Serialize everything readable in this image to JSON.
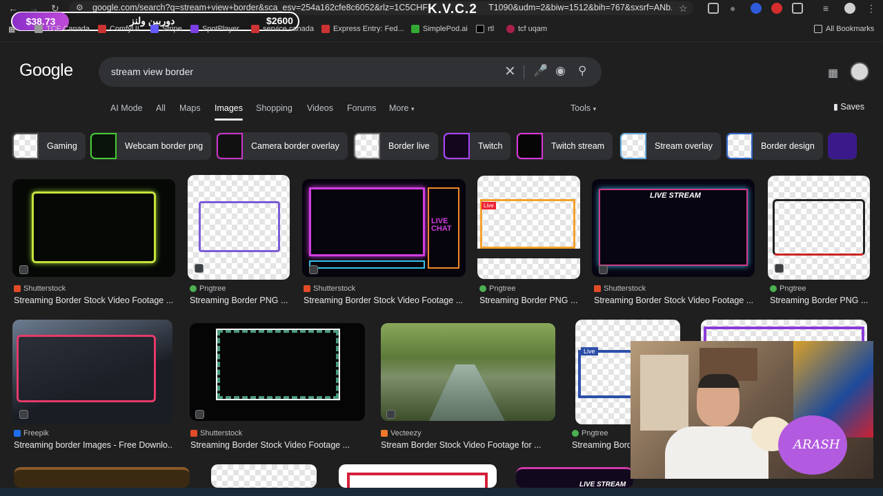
{
  "browser": {
    "url": "google.com/search?q=stream+view+border&sca_esv=254a162cfe8c6052&rlz=1C5CHF",
    "url_tail": "T1090&udm=2&biw=1512&bih=767&sxsrf=ANb...",
    "bookmarks": [
      "TCF Canada",
      "ComfyUI",
      "Stripe",
      "SpotPlayer",
      "service canada",
      "Express Entry: Fed...",
      "SimplePod.ai",
      "rtl",
      "tcf uqam",
      "All Bookmarks"
    ]
  },
  "overlay": {
    "left_money": "$38.73",
    "arabic": "دوربین ولنز",
    "right_money": "$2600",
    "brand": "K.V.C.2"
  },
  "google": {
    "logo": "Google",
    "query": "stream view border",
    "tabs": [
      "AI Mode",
      "All",
      "Maps",
      "Images",
      "Shopping",
      "Videos",
      "Forums",
      "More",
      "Tools"
    ],
    "saves": "Saves"
  },
  "chips": [
    "Gaming",
    "Webcam border png",
    "Camera border overlay",
    "Border live",
    "Twitch",
    "Twitch stream",
    "Stream overlay",
    "Border design"
  ],
  "results": [
    {
      "source": "Shutterstock",
      "title": "Streaming Border Stock Video Footage ..."
    },
    {
      "source": "Pngtree",
      "title": "Streaming Border PNG ..."
    },
    {
      "source": "Shutterstock",
      "title": "Streaming Border Stock Video Footage ..."
    },
    {
      "source": "Pngtree",
      "title": "Streaming Border PNG ..."
    },
    {
      "source": "Shutterstock",
      "title": "Streaming Border Stock Video Footage ..."
    },
    {
      "source": "Pngtree",
      "title": "Streaming Border PNG ..."
    },
    {
      "source": "Freepik",
      "title": "Streaming border Images - Free Downlo..."
    },
    {
      "source": "Shutterstock",
      "title": "Streaming Border Stock Video Footage ..."
    },
    {
      "source": "Vecteezy",
      "title": "Stream Border Stock Video Footage for ..."
    },
    {
      "source": "Pngtree",
      "title": "Streaming Bord"
    }
  ],
  "image_text": {
    "live_stream": "LIVE STREAM",
    "live_chat": "LIVE CHAT",
    "live": "Live",
    "webcam_name": "ARASH"
  }
}
